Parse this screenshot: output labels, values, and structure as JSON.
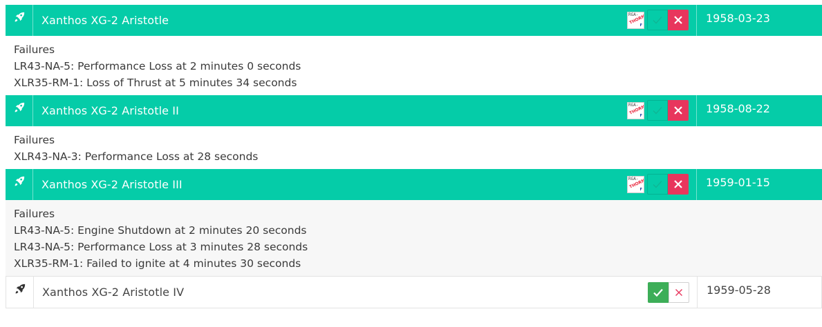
{
  "colors": {
    "failed_row_bg": "#05cca8",
    "success_check": "#3dae58",
    "fail_x": "#e8365d"
  },
  "badge": {
    "line1": "RGA-",
    "line2": "THORN",
    "line3": "F"
  },
  "launches": [
    {
      "name": "Xanthos XG-2 Aristotle",
      "date": "1958-03-23",
      "status": "failed",
      "failures_heading": "Failures",
      "failures": [
        "LR43-NA-5: Performance Loss at 2 minutes 0 seconds",
        "XLR35-RM-1: Loss of Thrust at 5 minutes 34 seconds"
      ]
    },
    {
      "name": "Xanthos XG-2 Aristotle II",
      "date": "1958-08-22",
      "status": "failed",
      "failures_heading": "Failures",
      "failures": [
        "XLR43-NA-3: Performance Loss at 28 seconds"
      ]
    },
    {
      "name": "Xanthos XG-2 Aristotle III",
      "date": "1959-01-15",
      "status": "failed",
      "failures_heading": "Failures",
      "failures": [
        "LR43-NA-5: Engine Shutdown at 2 minutes 20 seconds",
        "LR43-NA-5: Performance Loss at 3 minutes 28 seconds",
        "XLR35-RM-1: Failed to ignite at 4 minutes 30 seconds"
      ]
    },
    {
      "name": "Xanthos XG-2 Aristotle IV",
      "date": "1959-05-28",
      "status": "success"
    }
  ]
}
